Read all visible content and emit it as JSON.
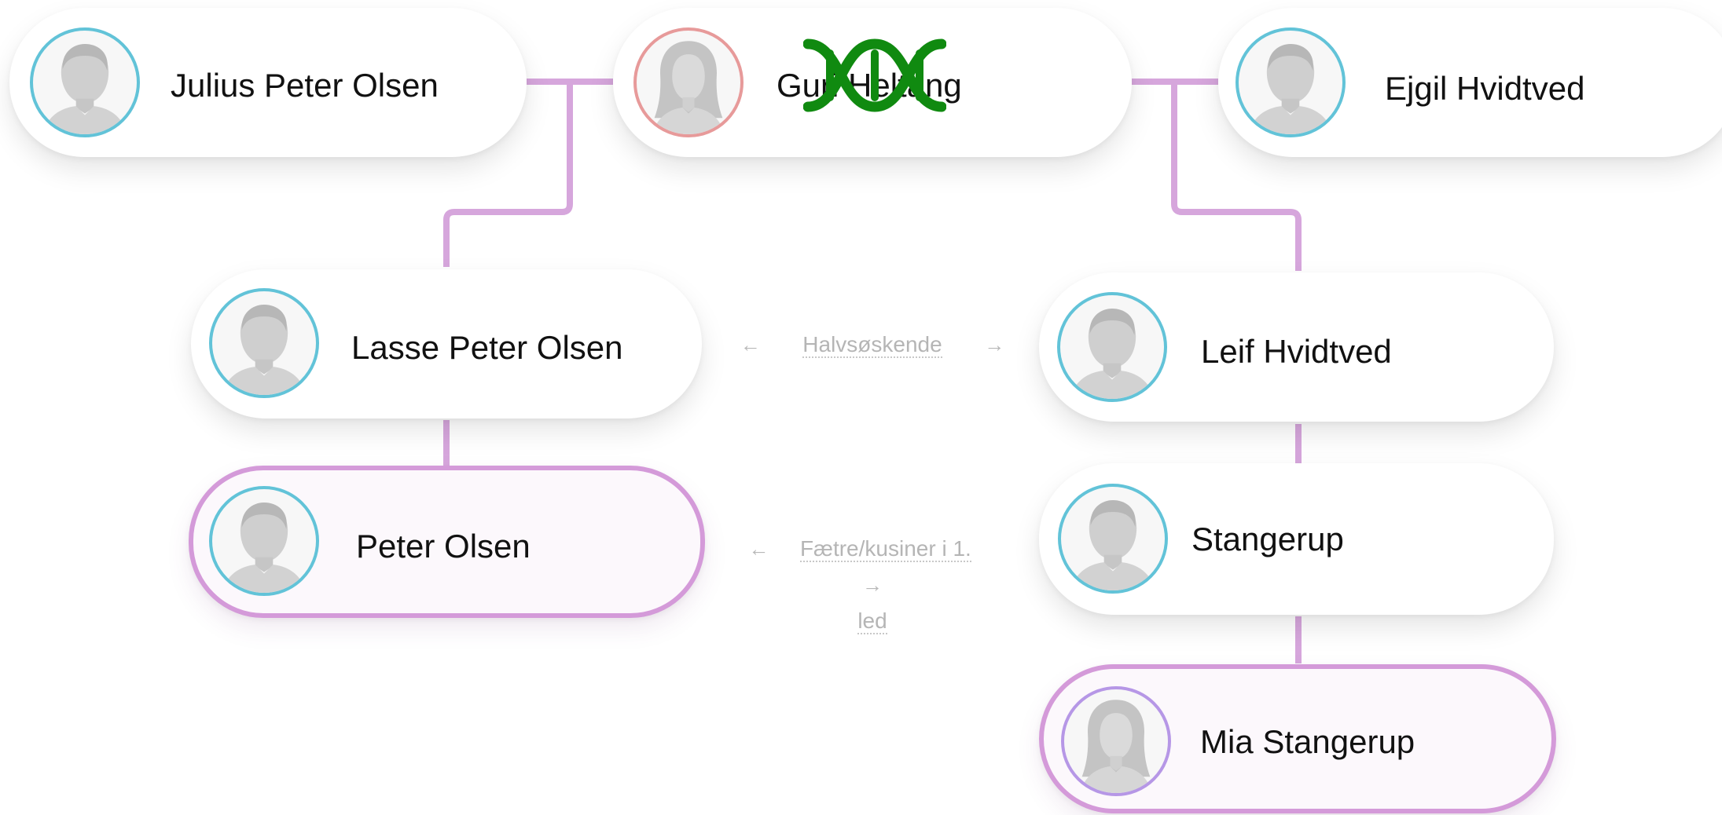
{
  "colors": {
    "connector": "#d6a6dc",
    "selected_border": "#d49ad9",
    "male_ring": "#62c3d8",
    "female_ring": "#e79a9a",
    "dna_icon": "#108a10"
  },
  "persons": {
    "julius": {
      "name": "Julius Peter Olsen",
      "gender": "male",
      "avatar_icon": "male-avatar-icon"
    },
    "guri": {
      "name": "Guri Heltang",
      "gender": "female",
      "avatar_icon": "female-avatar-icon"
    },
    "ejgil": {
      "name": "Ejgil Hvidtved",
      "gender": "male",
      "avatar_icon": "male-avatar-icon"
    },
    "lasse": {
      "name": "Lasse Peter Olsen",
      "gender": "male",
      "avatar_icon": "male-avatar-icon"
    },
    "leif": {
      "name": "Leif Hvidtved",
      "gender": "male",
      "avatar_icon": "male-avatar-icon"
    },
    "peter": {
      "name": "Peter Olsen",
      "gender": "male",
      "selected": true,
      "avatar_icon": "male-avatar-icon"
    },
    "stangerup": {
      "name": "Stangerup",
      "gender": "male",
      "avatar_icon": "male-avatar-icon"
    },
    "mia": {
      "name": "Mia Stangerup",
      "gender": "female",
      "selected": true,
      "avatar_icon": "female-avatar-icon"
    }
  },
  "relations": {
    "row1": {
      "label": "Halvsøskende",
      "left_arrow": "←",
      "right_arrow": "→"
    },
    "row2": {
      "label_line1": "Fætre/kusiner i 1.",
      "label_line2": "led",
      "left_arrow": "←",
      "right_arrow": "→"
    }
  },
  "dna_marker": {
    "icon": "dna-helix-icon"
  }
}
